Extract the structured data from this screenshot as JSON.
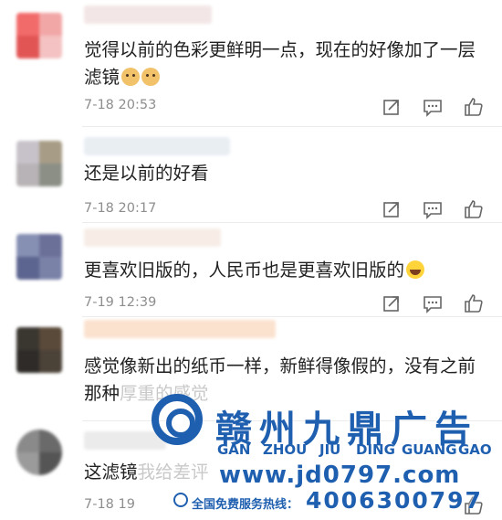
{
  "comments": [
    {
      "text": "觉得以前的色彩更鲜明一点，现在的好像加了一层滤镜",
      "time": "7-18 20:53",
      "emojis": [
        "doge-emoji",
        "doge-emoji"
      ],
      "avatar_colors": [
        "#f26b6b",
        "#f2a7a7",
        "#e25555",
        "#f4c2c2"
      ]
    },
    {
      "text": "还是以前的好看",
      "time": "7-18 20:17",
      "emojis": [],
      "avatar_colors": [
        "#c7c2c9",
        "#a79c86",
        "#b8b3b6",
        "#8b8f86"
      ]
    },
    {
      "text": "更喜欢旧版的，人民币也是更喜欢旧版的",
      "time": "7-19 12:39",
      "emojis": [
        "laughing-emoji"
      ],
      "avatar_colors": [
        "#8690b3",
        "#6b7099",
        "#5c6590",
        "#7a82a8"
      ]
    },
    {
      "text": "感觉像新出的纸币一样，新鲜得像假的，没有之前那种",
      "text_faded": "厚重的感觉",
      "time": "",
      "emojis": [],
      "avatar_colors": [
        "#3a3630",
        "#5a4a3a",
        "#2e2b28",
        "#4b4238"
      ]
    },
    {
      "text": "这滤镜",
      "text_faded": "我给差评",
      "time": "7-18 19",
      "emojis": [],
      "avatar_colors": [
        "#8a8a8a",
        "#6a6a6a",
        "#9b9b9b",
        "#555555"
      ]
    }
  ],
  "actions": {
    "repost_icon": "share-box-icon",
    "comment_icon": "comment-bubble-icon",
    "like_icon": "thumbs-up-icon"
  },
  "watermark": {
    "brand": "赣州九鼎广告",
    "pinyin": [
      "GAN",
      "ZHOU",
      "JIU",
      "DING",
      "GUANG",
      "GAO"
    ],
    "url": "www.jd0797.com",
    "hotline_label": "全国免费服务热线：",
    "hotline": "4006300797",
    "color": "#1f5fb0"
  }
}
